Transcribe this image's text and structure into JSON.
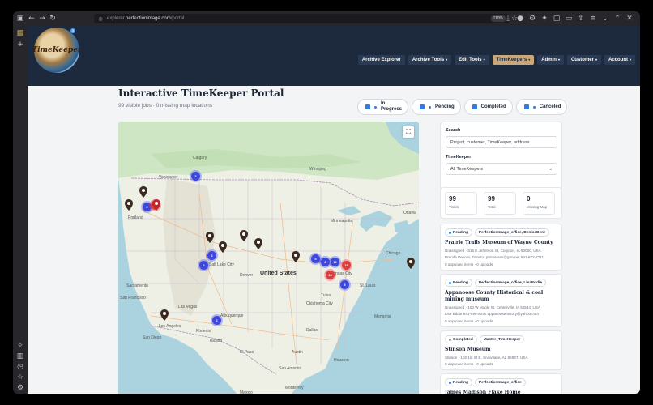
{
  "browser": {
    "url_prefix": "explorer.",
    "url_domain": "perfectionimage.com",
    "url_path": "/portal",
    "zoom": "110%"
  },
  "logo": {
    "text": "TimeKeeper",
    "badge": "0"
  },
  "nav": {
    "items": [
      {
        "label": "Archive Explorer",
        "caret": false,
        "active": false
      },
      {
        "label": "Archive Tools",
        "caret": true,
        "active": false
      },
      {
        "label": "Edit Tools",
        "caret": true,
        "active": false
      },
      {
        "label": "TimeKeepers",
        "caret": true,
        "active": true
      },
      {
        "label": "Admin",
        "caret": true,
        "active": false
      },
      {
        "label": "Customer",
        "caret": true,
        "active": false
      },
      {
        "label": "Account",
        "caret": true,
        "active": false
      }
    ]
  },
  "header": {
    "title": "Interactive TimeKeeper Portal",
    "subtitle": "99 visible jobs · 0 missing map locations"
  },
  "filters": [
    {
      "label": "In Progress",
      "dot": true
    },
    {
      "label": "Pending",
      "dot": true
    },
    {
      "label": "Completed",
      "dot": false
    },
    {
      "label": "Canceled",
      "dot": true
    }
  ],
  "map": {
    "country_label": "United States",
    "labels": [
      {
        "text": "Calgary"
      },
      {
        "text": "Vancouver"
      },
      {
        "text": "Winnipeg"
      },
      {
        "text": "Portland"
      },
      {
        "text": "Salt Lake City"
      },
      {
        "text": "Denver"
      },
      {
        "text": "Sacramento"
      },
      {
        "text": "San Francisco"
      },
      {
        "text": "Las Vegas"
      },
      {
        "text": "Los Angeles"
      },
      {
        "text": "San Diego"
      },
      {
        "text": "Phoenix"
      },
      {
        "text": "Tucson"
      },
      {
        "text": "Albuquerque"
      },
      {
        "text": "Oklahoma City"
      },
      {
        "text": "Dallas"
      },
      {
        "text": "Austin"
      },
      {
        "text": "Houston"
      },
      {
        "text": "San Antonio"
      },
      {
        "text": "Kansas City"
      },
      {
        "text": "St. Louis"
      },
      {
        "text": "Chicago"
      },
      {
        "text": "Minneapolis"
      },
      {
        "text": "Omaha"
      },
      {
        "text": "Memphis"
      },
      {
        "text": "Tulsa"
      },
      {
        "text": "El Paso"
      },
      {
        "text": "Monterrey"
      },
      {
        "text": "Ottawa"
      },
      {
        "text": "Mexico"
      }
    ],
    "clusters": [
      {
        "color": "blue",
        "count": "3"
      },
      {
        "color": "blue",
        "count": "2"
      },
      {
        "color": "red",
        "count": "2"
      },
      {
        "color": "blue",
        "count": "2"
      },
      {
        "color": "blue",
        "count": "2"
      },
      {
        "color": "blue",
        "count": "5"
      },
      {
        "color": "blue",
        "count": "8"
      },
      {
        "color": "blue",
        "count": "12"
      },
      {
        "color": "red",
        "count": "15"
      },
      {
        "color": "red",
        "count": "10"
      },
      {
        "color": "blue",
        "count": "5"
      },
      {
        "color": "blue",
        "count": "2"
      }
    ]
  },
  "search": {
    "search_label": "Search",
    "search_placeholder": "Project, customer, TimeKeeper, address",
    "tk_label": "TimeKeeper",
    "tk_value": "All TimeKeepers"
  },
  "stats": [
    {
      "value": "99",
      "label": "Visible"
    },
    {
      "value": "99",
      "label": "Total"
    },
    {
      "value": "0",
      "label": "Missing Map"
    }
  ],
  "jobs": [
    {
      "status": "Pending",
      "owner": "PerfectionImage_office, DeniseDent",
      "name": "Prairie Trails Museum of Wayne County",
      "address": "Unassigned · 515 E Jefferson St, Corydon, IA 50060, USA",
      "contact": "Brenda Devore, Director ptmuseum@grm.net 641-872-2211",
      "progress": "0 approved items · 0 uploads"
    },
    {
      "status": "Pending",
      "owner": "PerfectionImage_office, LisaEddie",
      "name": "Appanoose County Historical & coal mining museum",
      "address": "Unassigned · 100 W Maple St, Centerville, IA 52544, USA",
      "contact": "Lisa Eddie 641-856-8040 appanoosehistory@yahoo.com",
      "progress": "0 approved items · 0 uploads"
    },
    {
      "status": "Completed",
      "owner": "Master_TimeKeeper",
      "name": "Stinson Museum",
      "address": "Stinson · 102 1st St E, Snowflake, AZ 85937, USA",
      "contact": "",
      "progress": "0 approved items · 0 uploads"
    },
    {
      "status": "Pending",
      "owner": "PerfectionImage_office",
      "name": "James Madison Flake Home",
      "address": "Unassigned · 19 N 1st St W, Snowflake, AZ 85937, USA",
      "contact": "",
      "progress": "0 approved items · 0 uploads"
    }
  ]
}
